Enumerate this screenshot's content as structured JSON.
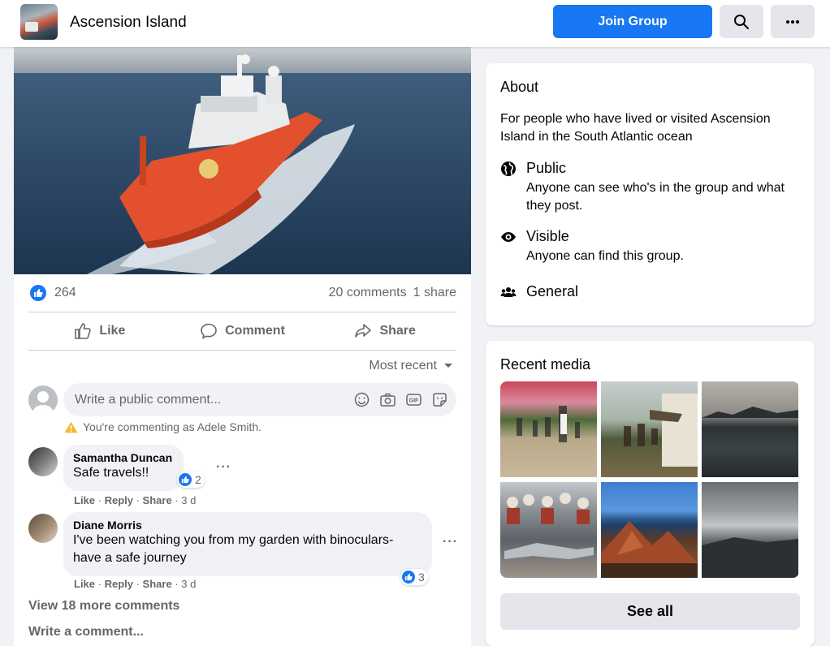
{
  "header": {
    "group_name": "Ascension Island",
    "join_label": "Join Group",
    "search_icon": "search-icon",
    "more_icon": "more-icon"
  },
  "post": {
    "image_icon": "ship-photo",
    "reactions_count": "264",
    "comments_count": "20 comments",
    "shares_count": "1 share",
    "actions": {
      "like": "Like",
      "comment": "Comment",
      "share": "Share"
    },
    "sort_label": "Most recent",
    "comment_placeholder": "Write a public comment...",
    "commenting_as": "You're commenting as Adele Smith.",
    "comments": [
      {
        "author": "Samantha Duncan",
        "text": "Safe travels!!",
        "reactions": "2",
        "like": "Like",
        "reply": "Reply",
        "share": "Share",
        "time": "3 d"
      },
      {
        "author": "Diane Morris",
        "text_line1": "I've been watching you from my garden with binoculars-",
        "text_line2": "have a safe journey",
        "reactions": "3",
        "like": "Like",
        "reply": "Reply",
        "share": "Share",
        "time": "3 d"
      }
    ],
    "view_more": "View 18 more comments",
    "write_comment": "Write a comment..."
  },
  "about": {
    "title": "About",
    "description": "For people who have lived or visited Ascension Island in the South Atlantic ocean",
    "public_label": "Public",
    "public_sub": "Anyone can see who's in the group and what they post.",
    "visible_label": "Visible",
    "visible_sub": "Anyone can find this group.",
    "general_label": "General"
  },
  "recent_media": {
    "title": "Recent media",
    "see_all": "See all"
  },
  "colors": {
    "accent": "#1877f2",
    "background": "#f0f2f5",
    "secondary_text": "#65676b"
  }
}
